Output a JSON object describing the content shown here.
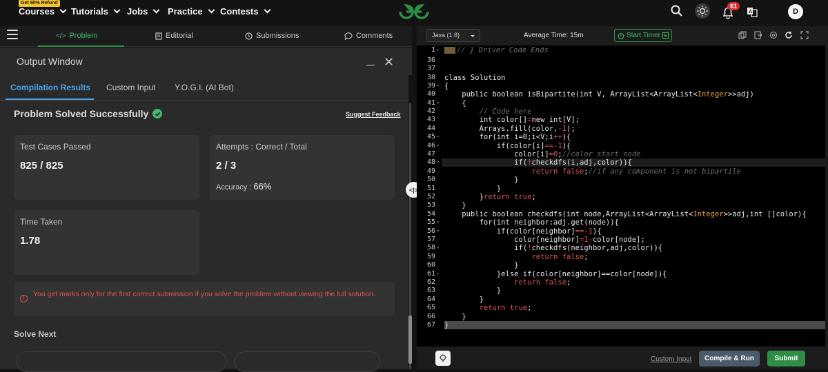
{
  "nav": {
    "badge": "Get 90% Refund",
    "items": [
      "Courses",
      "Tutorials",
      "Jobs",
      "Practice",
      "Contests"
    ],
    "notification_count": "61",
    "avatar_initial": "D"
  },
  "left_tabs": {
    "problem": "Problem",
    "editorial": "Editorial",
    "submissions": "Submissions",
    "comments": "Comments"
  },
  "output": {
    "title": "Output Window",
    "subtabs": [
      "Compilation Results",
      "Custom Input",
      "Y.O.G.I. (AI Bot)"
    ],
    "status": "Problem Solved Successfully",
    "feedback": "Suggest Feedback",
    "test_cases_label": "Test Cases Passed",
    "test_cases_value": "825 / 825",
    "attempts_label": "Attempts : Correct / Total",
    "attempts_value": "2 / 3",
    "accuracy_label": "Accuracy :",
    "accuracy_value": "66%",
    "time_label": "Time Taken",
    "time_value": "1.78",
    "warning": "You get marks only for the first correct submission if you solve the problem without viewing the full solution.",
    "solve_next": "Solve Next"
  },
  "editor": {
    "language": "Java (1.8)",
    "average_time": "Average Time: 15m",
    "start_timer": "Start Timer",
    "line_numbers": [
      "1",
      "36",
      "37",
      "38",
      "39",
      "40",
      "41",
      "42",
      "43",
      "44",
      "45",
      "46",
      "47",
      "48",
      "49",
      "50",
      "51",
      "52",
      "53",
      "54",
      "55",
      "56",
      "57",
      "58",
      "59",
      "60",
      "61",
      "62",
      "63",
      "64",
      "65",
      "66",
      "67"
    ]
  },
  "bottom": {
    "custom_input": "Custom Input",
    "compile_run": "Compile & Run",
    "submit": "Submit"
  },
  "colors": {
    "accent_green": "#2f8d46",
    "link_blue": "#4aa3e8",
    "error_red": "#e05252"
  }
}
